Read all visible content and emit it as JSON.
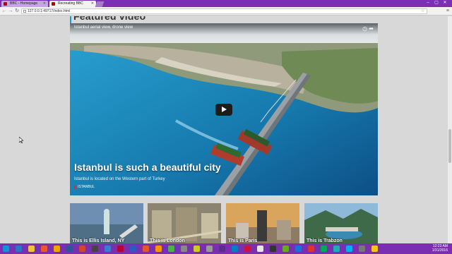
{
  "browser": {
    "tabs": [
      {
        "label": "BBC - Homepage"
      },
      {
        "label": "Recreating BBC"
      }
    ],
    "url": "127.0.0.1:49717/index.html"
  },
  "page": {
    "section_heading": "Featured video",
    "video": {
      "caption_top": "Istanbul aerial view, drone view",
      "title": "Istanbul is such a beautiful city",
      "subtitle": "Istanbul is located on the Western part of Turkey",
      "tag": "ISTANBUL"
    },
    "thumbnails": [
      {
        "label": "This is Ellis Island, NY"
      },
      {
        "label": "This is London"
      },
      {
        "label": "This is Paris"
      },
      {
        "label": "This is Trabzon"
      }
    ]
  },
  "taskbar": {
    "time": "12:23 AM",
    "date": "1/31/2016"
  },
  "colors": {
    "accent": "#1a9ad6",
    "chrome": "#7b2fb5"
  }
}
